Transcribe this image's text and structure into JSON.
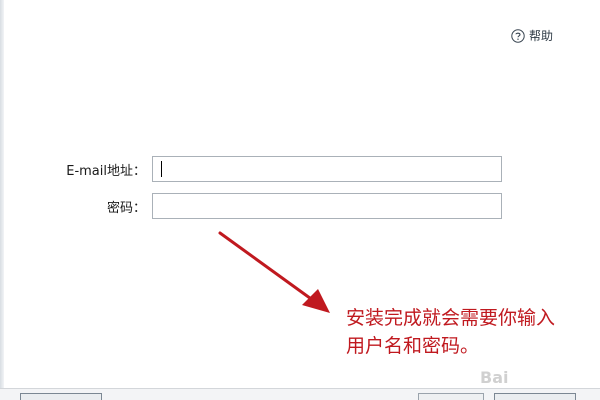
{
  "header": {
    "help_label": "帮助"
  },
  "form": {
    "email_label": "E-mail地址：",
    "email_value": "",
    "password_label": "密码：",
    "password_value": ""
  },
  "annotation": {
    "line1": "安装完成就会需要你输入",
    "line2": "用户名和密码。",
    "color": "#c0191f"
  },
  "watermark": {
    "text": "Bai"
  },
  "icons": {
    "help": "question-circle-icon"
  }
}
